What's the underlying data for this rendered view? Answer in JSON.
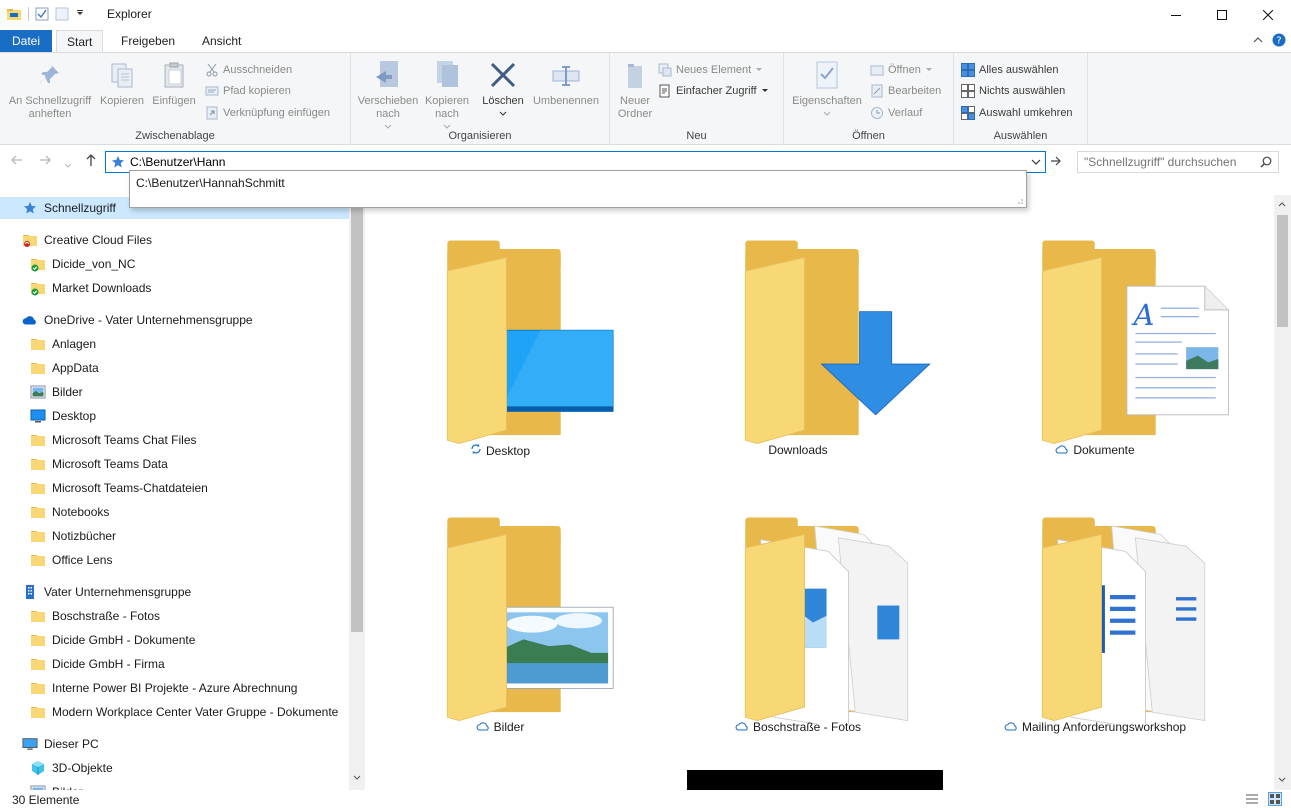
{
  "window": {
    "title": "Explorer"
  },
  "tabs": [
    {
      "label": "Datei"
    },
    {
      "label": "Start"
    },
    {
      "label": "Freigeben"
    },
    {
      "label": "Ansicht"
    }
  ],
  "ribbon": {
    "clipboard": {
      "label": "Zwischenablage",
      "pin": "An Schnellzugriff\nanheften",
      "copy": "Kopieren",
      "paste": "Einfügen",
      "cut": "Ausschneiden",
      "copy_path": "Pfad kopieren",
      "paste_shortcut": "Verknüpfung einfügen"
    },
    "organize": {
      "label": "Organisieren",
      "move": "Verschieben\nnach",
      "copyto": "Kopieren\nnach",
      "delete": "Löschen",
      "rename": "Umbenennen"
    },
    "new": {
      "label": "Neu",
      "new_folder": "Neuer\nOrdner",
      "new_item": "Neues Element",
      "easy_access": "Einfacher Zugriff"
    },
    "open": {
      "label": "Öffnen",
      "properties": "Eigenschaften",
      "open": "Öffnen",
      "edit": "Bearbeiten",
      "history": "Verlauf"
    },
    "select": {
      "label": "Auswählen",
      "select_all": "Alles auswählen",
      "select_none": "Nichts auswählen",
      "invert": "Auswahl umkehren"
    }
  },
  "address": {
    "value": "C:\\Benutzer\\Hann",
    "suggestion": "C:\\Benutzer\\HannahSchmitt"
  },
  "search": {
    "placeholder": "\"Schnellzugriff\" durchsuchen"
  },
  "nav": [
    {
      "label": "Schnellzugriff",
      "icon": "star-icon",
      "level": 0,
      "selected": true
    },
    {
      "label": "Creative Cloud Files",
      "icon": "creative-cloud-folder-icon",
      "level": 0
    },
    {
      "label": "Dicide_von_NC",
      "icon": "synced-folder-icon",
      "level": 1
    },
    {
      "label": "Market Downloads",
      "icon": "synced-folder-icon",
      "level": 1
    },
    {
      "label": "OneDrive - Vater Unternehmensgruppe",
      "icon": "onedrive-cloud-icon",
      "level": 0
    },
    {
      "label": "Anlagen",
      "icon": "folder-icon",
      "level": 1
    },
    {
      "label": "AppData",
      "icon": "folder-icon",
      "level": 1
    },
    {
      "label": "Bilder",
      "icon": "pictures-icon",
      "level": 1
    },
    {
      "label": "Desktop",
      "icon": "desktop-icon",
      "level": 1
    },
    {
      "label": "Microsoft Teams Chat Files",
      "icon": "folder-icon",
      "level": 1
    },
    {
      "label": "Microsoft Teams Data",
      "icon": "folder-icon",
      "level": 1
    },
    {
      "label": "Microsoft Teams-Chatdateien",
      "icon": "folder-icon",
      "level": 1
    },
    {
      "label": "Notebooks",
      "icon": "folder-icon",
      "level": 1
    },
    {
      "label": "Notizbücher",
      "icon": "folder-icon",
      "level": 1
    },
    {
      "label": "Office Lens",
      "icon": "folder-icon",
      "level": 1
    },
    {
      "label": "Vater Unternehmensgruppe",
      "icon": "building-icon",
      "level": 0
    },
    {
      "label": "Boschstraße - Fotos",
      "icon": "folder-icon",
      "level": 1
    },
    {
      "label": "Dicide GmbH - Dokumente",
      "icon": "folder-icon",
      "level": 1
    },
    {
      "label": "Dicide GmbH - Firma",
      "icon": "folder-icon",
      "level": 1
    },
    {
      "label": "Interne Power BI Projekte - Azure Abrechnung",
      "icon": "folder-icon",
      "level": 1
    },
    {
      "label": "Modern Workplace Center Vater Gruppe - Dokumente",
      "icon": "folder-icon",
      "level": 1
    },
    {
      "label": "Dieser PC",
      "icon": "pc-icon",
      "level": 0
    },
    {
      "label": "3D-Objekte",
      "icon": "3d-objects-icon",
      "level": 1
    },
    {
      "label": "Bilder",
      "icon": "pictures-icon",
      "level": 1
    }
  ],
  "tiles": [
    {
      "label": "Desktop",
      "status": "sync-icon",
      "overlay": "desktop"
    },
    {
      "label": "Downloads",
      "status": "",
      "overlay": "download"
    },
    {
      "label": "Dokumente",
      "status": "cloud-icon",
      "overlay": "document"
    },
    {
      "label": "Bilder",
      "status": "cloud-icon",
      "overlay": "picture"
    },
    {
      "label": "Boschstraße - Fotos",
      "status": "cloud-icon",
      "overlay": "photos"
    },
    {
      "label": "Mailing Anforderungsworkshop",
      "status": "cloud-icon",
      "overlay": "word"
    }
  ],
  "status": {
    "count": "30 Elemente"
  },
  "colors": {
    "accent": "#1a6dc4",
    "folder": "#f8d775",
    "folder_dark": "#e8b94a",
    "selection": "#cce8ff"
  }
}
